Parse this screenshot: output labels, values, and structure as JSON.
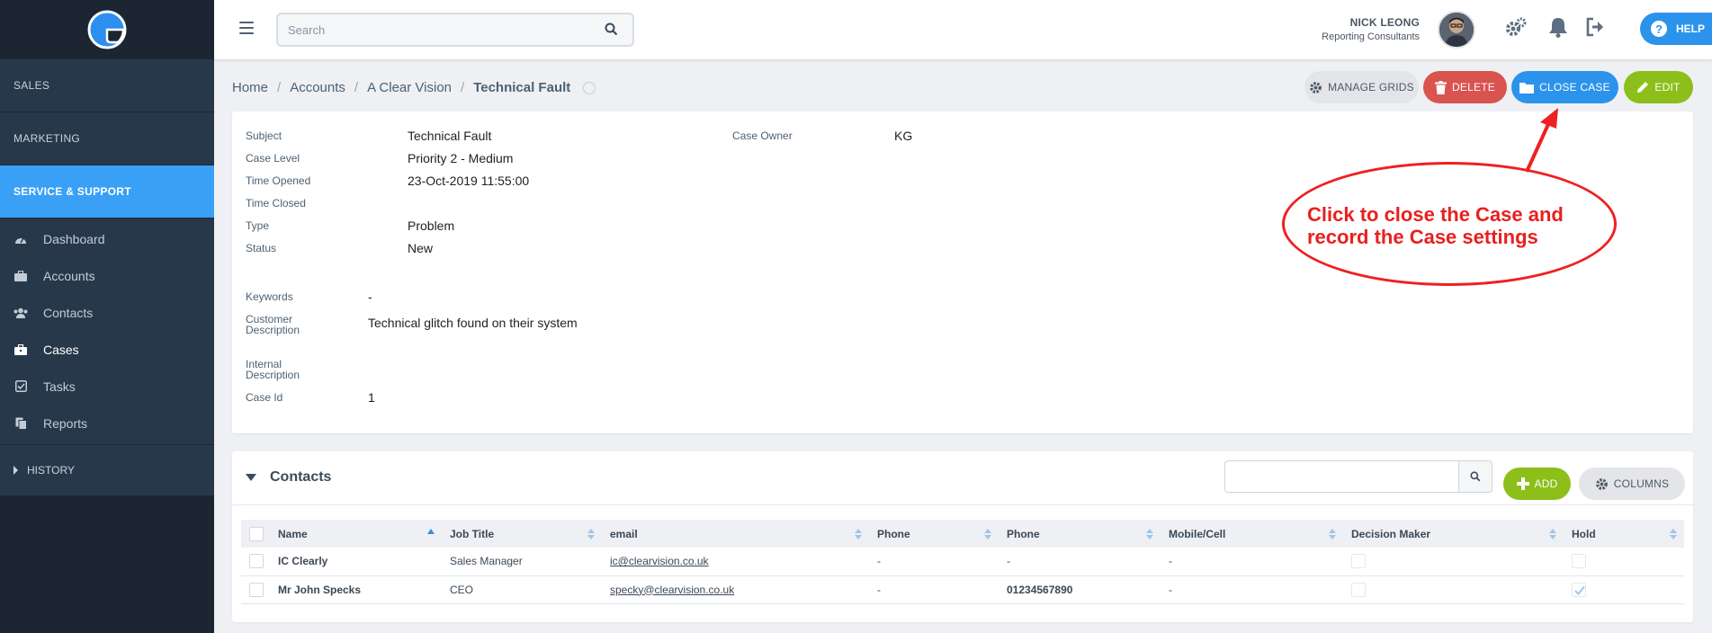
{
  "sidebar": {
    "sections": {
      "sales": "SALES",
      "marketing": "MARKETING",
      "service": "SERVICE & SUPPORT"
    },
    "items": [
      {
        "label": "Dashboard",
        "icon": "dashboard-icon"
      },
      {
        "label": "Accounts",
        "icon": "briefcase-icon"
      },
      {
        "label": "Contacts",
        "icon": "users-icon"
      },
      {
        "label": "Cases",
        "icon": "case-icon"
      },
      {
        "label": "Tasks",
        "icon": "check-square-icon"
      },
      {
        "label": "Reports",
        "icon": "reports-icon"
      }
    ],
    "history": "HISTORY"
  },
  "topbar": {
    "search_placeholder": "Search",
    "user_name": "NICK LEONG",
    "user_role": "Reporting Consultants",
    "help_label": "HELP"
  },
  "breadcrumb": [
    "Home",
    "Accounts",
    "A Clear Vision",
    "Technical Fault"
  ],
  "actions": {
    "manage_grids": "MANAGE GRIDS",
    "delete": "DELETE",
    "close_case": "CLOSE CASE",
    "edit": "EDIT"
  },
  "case": {
    "subject_label": "Subject",
    "subject": "Technical Fault",
    "level_label": "Case Level",
    "level": "Priority 2 - Medium",
    "opened_label": "Time Opened",
    "opened": "23-Oct-2019 11:55:00",
    "closed_label": "Time Closed",
    "closed": "",
    "type_label": "Type",
    "type": "Problem",
    "status_label": "Status",
    "status": "New",
    "owner_label": "Case Owner",
    "owner": "KG",
    "keywords_label": "Keywords",
    "keywords": "-",
    "cust_desc_label_1": "Customer",
    "cust_desc_label_2": "Description",
    "cust_desc": "Technical glitch found on their system",
    "int_desc_label_1": "Internal",
    "int_desc_label_2": "Description",
    "int_desc": "",
    "id_label": "Case Id",
    "id": "1"
  },
  "callout": {
    "line1": "Click to close the Case and",
    "line2": "record the Case settings"
  },
  "contacts": {
    "title": "Contacts",
    "add_label": "ADD",
    "columns_label": "COLUMNS",
    "headers": [
      "Name",
      "Job Title",
      "email",
      "Phone",
      "Phone",
      "Mobile/Cell",
      "Decision Maker",
      "Hold"
    ],
    "rows": [
      {
        "name": "IC Clearly",
        "job": "Sales Manager",
        "email": "ic@clearvision.co.uk",
        "phone1": "-",
        "phone2": "-",
        "mobile": "-",
        "decision_maker": false,
        "hold": false
      },
      {
        "name": "Mr John Specks",
        "job": "CEO",
        "email": "specky@clearvision.co.uk",
        "phone1": "-",
        "phone2": "01234567890",
        "mobile": "-",
        "decision_maker": false,
        "hold": true
      }
    ]
  },
  "colors": {
    "accent": "#3aa0f5",
    "danger": "#d9534f",
    "success": "#8cbf1a",
    "annotation": "#e8201f"
  }
}
